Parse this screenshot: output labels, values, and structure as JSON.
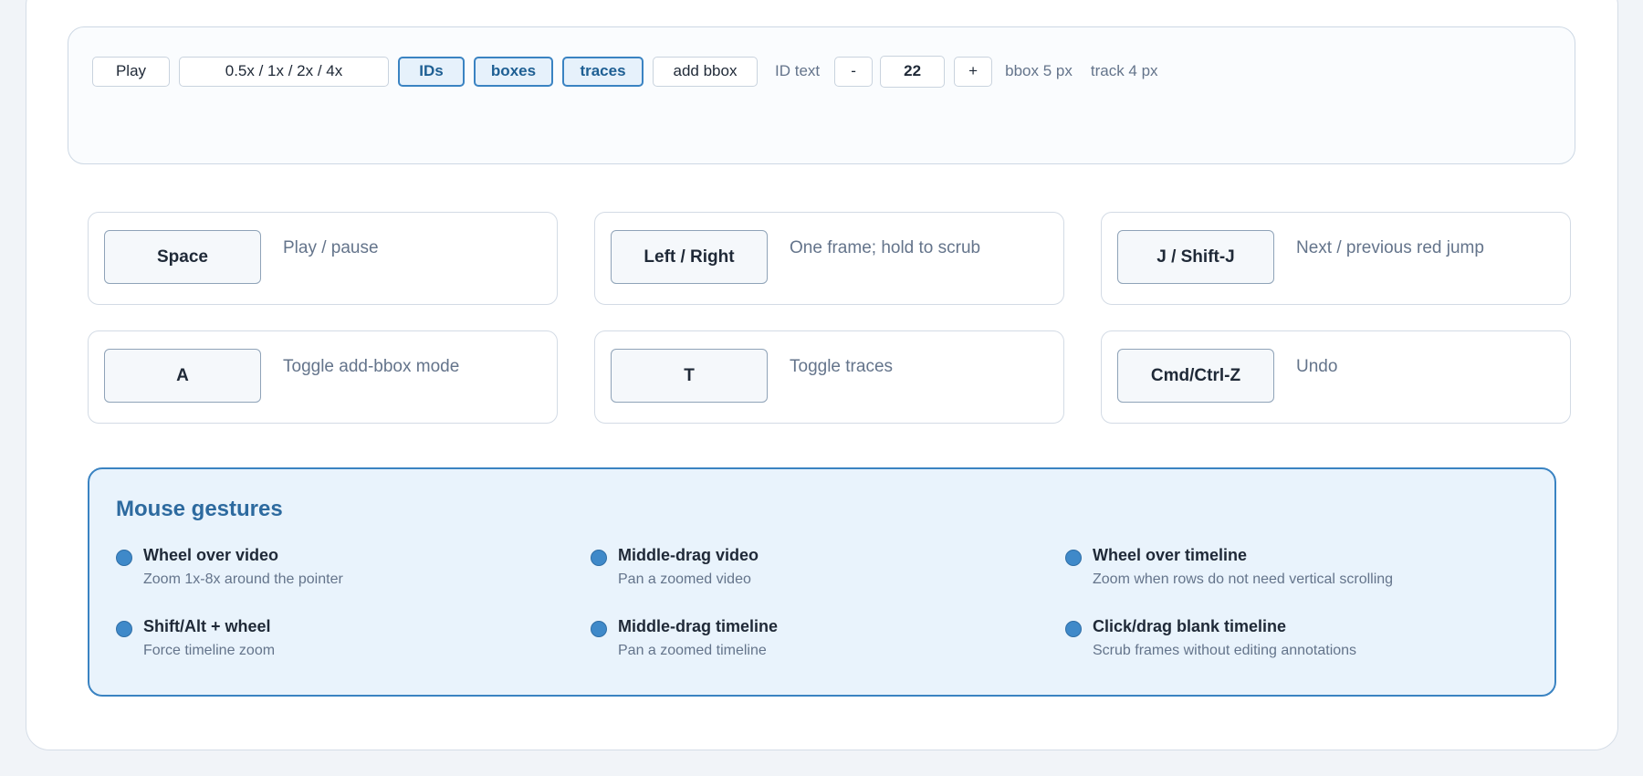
{
  "toolbar": {
    "play_label": "Play",
    "speed_label": "0.5x / 1x / 2x / 4x",
    "ids_label": "IDs",
    "boxes_label": "boxes",
    "traces_label": "traces",
    "add_bbox_label": "add bbox",
    "id_text_label": "ID text",
    "decrement_label": "-",
    "font_size_value": "22",
    "increment_label": "+",
    "bbox_width_label": "bbox 5 px",
    "track_width_label": "track 4 px",
    "active_toggles": [
      "IDs",
      "boxes",
      "traces"
    ]
  },
  "shortcuts": [
    {
      "key": "Space",
      "description": "Play / pause"
    },
    {
      "key": "Left / Right",
      "description": "One frame; hold to scrub"
    },
    {
      "key": "J / Shift-J",
      "description": "Next / previous red jump"
    },
    {
      "key": "A",
      "description": "Toggle add-bbox mode"
    },
    {
      "key": "T",
      "description": "Toggle traces"
    },
    {
      "key": "Cmd/Ctrl-Z",
      "description": "Undo"
    }
  ],
  "gestures": {
    "title": "Mouse gestures",
    "items": [
      {
        "title": "Wheel over video",
        "description": "Zoom 1x-8x around the pointer"
      },
      {
        "title": "Middle-drag video",
        "description": "Pan a zoomed video"
      },
      {
        "title": "Wheel over timeline",
        "description": "Zoom when rows do not need vertical scrolling"
      },
      {
        "title": "Shift/Alt + wheel",
        "description": "Force timeline zoom"
      },
      {
        "title": "Middle-drag timeline",
        "description": "Pan a zoomed timeline"
      },
      {
        "title": "Click/drag blank timeline",
        "description": "Scrub frames without editing annotations"
      }
    ]
  },
  "colors": {
    "accent": "#3a83c2",
    "accent_text": "#2d6a9f",
    "panel_background": "#e9f3fc",
    "bullet": "#3f89c9",
    "muted_text": "#64748b"
  },
  "icons": {
    "gesture_bullet": "filled-circle"
  }
}
